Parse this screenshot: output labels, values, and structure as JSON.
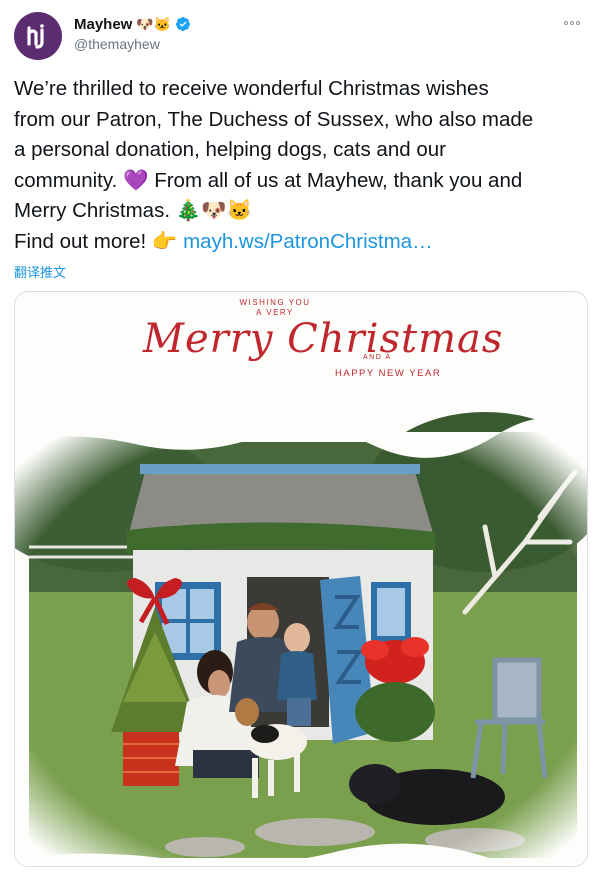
{
  "account": {
    "display_name": "Mayhew",
    "name_emojis": "🐶🐱",
    "handle": "@themayhew"
  },
  "tweet": {
    "lines": [
      "We’re thrilled to receive wonderful Christmas wishes",
      "from our Patron, The Duchess of Sussex, who also made",
      "a personal donation, helping dogs, cats and our",
      "community. 💜 From all of us at Mayhew, thank you and",
      "Merry Christmas. 🎄🐶🐱"
    ],
    "find_out_prefix": "Find out more! 👉 ",
    "link_text": "mayh.ws/PatronChristma…",
    "translate_label": "翻译推文"
  },
  "card": {
    "top_line_1": "WISHING YOU",
    "top_line_2": "A VERY",
    "merry_christmas": "Merry Christmas",
    "and_a": "AND A",
    "happy_new_year": "HAPPY NEW YEAR"
  },
  "colors": {
    "brand_purple": "#5b2c6f",
    "link_blue": "#1b95e0",
    "card_red": "#c0272d"
  }
}
